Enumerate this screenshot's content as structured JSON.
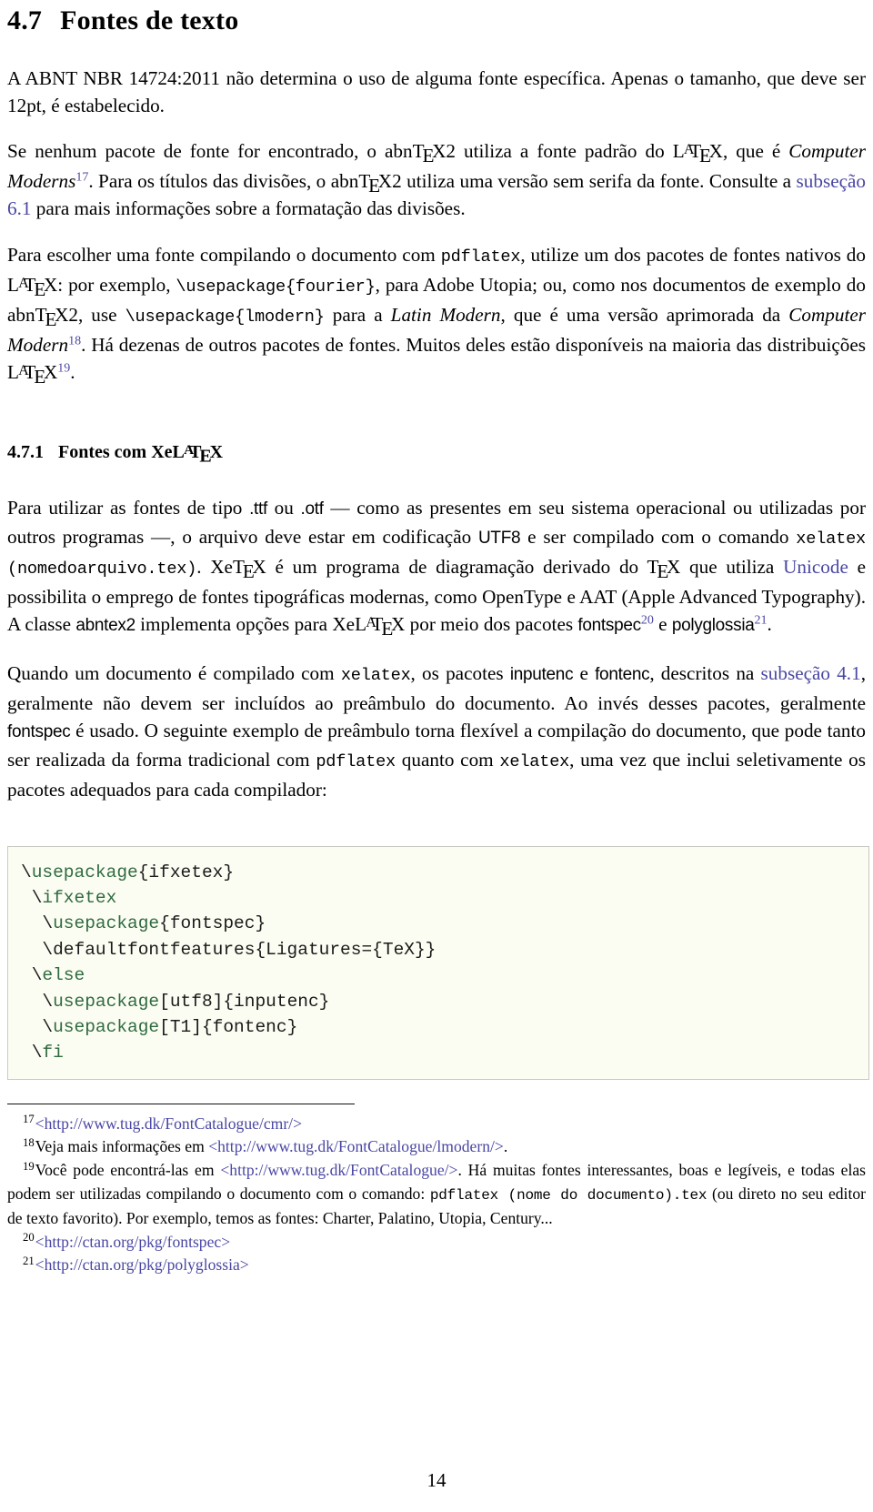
{
  "document": {
    "page_number": "14",
    "link_color": "#4a47a3",
    "code_bg_color": "#fcfdf2",
    "code_keyword_color": "#2f6b40",
    "code_border_color": "#c9c9c4"
  },
  "section": {
    "number": "4.7",
    "title": "Fontes de texto"
  },
  "subsection": {
    "number": "4.7.1",
    "title_prefix": "Fontes com Xe"
  },
  "paragraphs": {
    "p1": {
      "t1": "A ABNT NBR 14724:2011 não determina o uso de alguma fonte específica. Apenas o tamanho, que deve ser 12pt, é estabelecido."
    },
    "p2": {
      "t1": "Se nenhum pacote de fonte for encontrado, o abn",
      "t2": "2 utiliza a fonte padrão do ",
      "t3": ", que é ",
      "t4": "Computer Moderns",
      "fn": "17",
      "t5": ". Para os títulos das divisões, o abn",
      "t6": "2 utiliza uma versão sem serifa da fonte. Consulte a ",
      "link": "subseção 6.1",
      "t7": " para mais informações sobre a formatação das divisões."
    },
    "p3": {
      "t1": "Para escolher uma fonte compilando o documento com ",
      "code1": "pdflatex",
      "t2": ", utilize um dos pacotes de fontes nativos do ",
      "t3": ": por exemplo, ",
      "code2": "\\usepackage{fourier}",
      "t4": ", para Adobe Utopia; ou, como nos documentos de exemplo do abn",
      "t5": "2, use ",
      "code3": "\\usepackage{lmodern}",
      "t6": " para a ",
      "it1": "Latin Modern",
      "t7": ", que é uma versão aprimorada da ",
      "it2": "Computer Modern",
      "fn1": "18",
      "t8": ". Há dezenas de outros pacotes de fontes. Muitos deles estão disponíveis na maioria das distribuições ",
      "fn2": "19",
      "t9": "."
    },
    "p4": {
      "t1": "Para utilizar as fontes de tipo ",
      "sf1": ".ttf",
      "t2": " ou ",
      "sf2": ".otf",
      "t3": " — como as presentes em seu sistema operacional ou utilizadas por outros programas —, o arquivo deve estar em codificação ",
      "sf3": "UTF8",
      "t4": " e ser compilado com o comando ",
      "code1": "xelatex (nomedoarquivo.tex)",
      "t5": ". Xe",
      "t6": " é um programa de diagramação derivado do ",
      "t7": " que utiliza ",
      "link": "Unicode",
      "t8": " e possibilita o emprego de fontes tipográficas modernas, como OpenType e AAT (Apple Advanced Typography). A classe ",
      "sf4": "abntex2",
      "t9": " implementa opções para Xe",
      "t10": " por meio dos pacotes ",
      "sf5": "fontspec",
      "fn1": "20",
      "t11": " e ",
      "sf6": "polyglossia",
      "fn2": "21",
      "t12": "."
    },
    "p5": {
      "t1": "Quando um documento é compilado com ",
      "code1": "xelatex",
      "t2": ", os pacotes ",
      "sf1": "inputenc",
      "t3": " e ",
      "sf2": "fontenc",
      "t4": ", descritos na ",
      "link": "subseção 4.1",
      "t5": ", geralmente não devem ser incluídos ao preâmbulo do documento. Ao invés desses pacotes, geralmente ",
      "sf3": "fontspec",
      "t6": " é usado. O seguinte exemplo de preâmbulo torna flexível a compilação do documento, que pode tanto ser realizada da forma tradicional com ",
      "code2": "pdflatex",
      "t7": " quanto com ",
      "code3": "xelatex",
      "t8": ", uma vez que inclui seletivamente os pacotes adequados para cada compilador:"
    }
  },
  "code_block": {
    "lines": [
      [
        {
          "t": "\\",
          "k": false
        },
        {
          "t": "usepackage",
          "k": true
        },
        {
          "t": "{ifxetex}",
          "k": false
        }
      ],
      [
        {
          "t": " \\",
          "k": false
        },
        {
          "t": "ifxetex",
          "k": true
        }
      ],
      [
        {
          "t": "  \\",
          "k": false
        },
        {
          "t": "usepackage",
          "k": true
        },
        {
          "t": "{fontspec}",
          "k": false
        }
      ],
      [
        {
          "t": "  \\defaultfontfeatures{Ligatures={TeX}}",
          "k": false
        }
      ],
      [
        {
          "t": " \\",
          "k": false
        },
        {
          "t": "else",
          "k": true
        }
      ],
      [
        {
          "t": "  \\",
          "k": false
        },
        {
          "t": "usepackage",
          "k": true
        },
        {
          "t": "[utf8]{inputenc}",
          "k": false
        }
      ],
      [
        {
          "t": "  \\",
          "k": false
        },
        {
          "t": "usepackage",
          "k": true
        },
        {
          "t": "[T1]{fontenc}",
          "k": false
        }
      ],
      [
        {
          "t": " \\",
          "k": false
        },
        {
          "t": "fi",
          "k": true
        }
      ]
    ]
  },
  "footnotes": [
    {
      "mark": "17",
      "parts": [
        {
          "type": "url",
          "text": "<http://www.tug.dk/FontCatalogue/cmr/>"
        }
      ]
    },
    {
      "mark": "18",
      "parts": [
        {
          "type": "text",
          "text": "Veja mais informações em "
        },
        {
          "type": "url",
          "text": "<http://www.tug.dk/FontCatalogue/lmodern/>"
        },
        {
          "type": "text",
          "text": "."
        }
      ]
    },
    {
      "mark": "19",
      "parts": [
        {
          "type": "text",
          "text": "Você pode encontrá-las em "
        },
        {
          "type": "url",
          "text": "<http://www.tug.dk/FontCatalogue/>"
        },
        {
          "type": "text",
          "text": ". Há muitas fontes interessantes, boas e legíveis, e todas elas podem ser utilizadas compilando o documento com o comando: "
        },
        {
          "type": "code",
          "text": "pdflatex (nome do documento).tex"
        },
        {
          "type": "text",
          "text": " (ou direto no seu editor de texto favorito). Por exemplo, temos as fontes: Charter, Palatino, Utopia, Century..."
        }
      ]
    },
    {
      "mark": "20",
      "parts": [
        {
          "type": "url",
          "text": "<http://ctan.org/pkg/fontspec>"
        }
      ]
    },
    {
      "mark": "21",
      "parts": [
        {
          "type": "url",
          "text": "<http://ctan.org/pkg/polyglossia>"
        }
      ]
    }
  ]
}
